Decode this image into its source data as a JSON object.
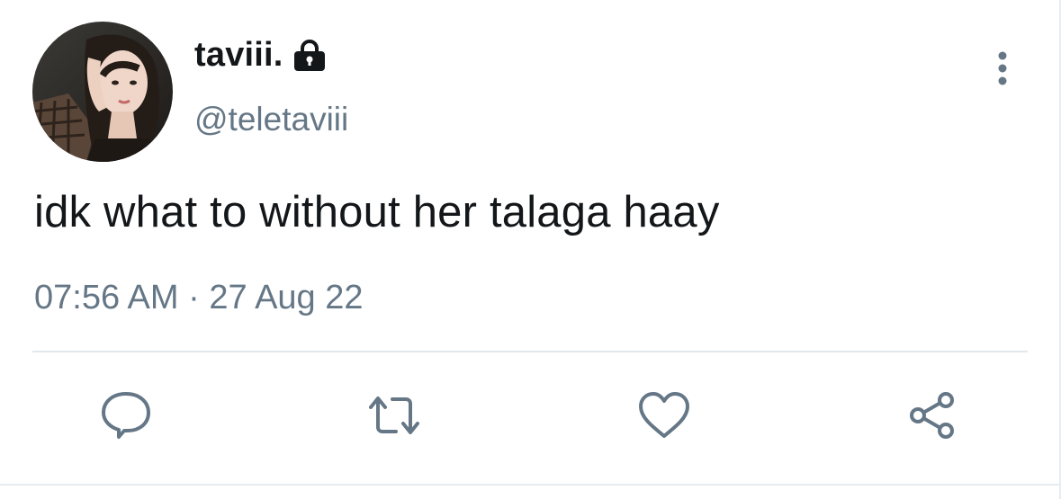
{
  "user": {
    "display_name": "taviii.",
    "handle": "@teletaviii",
    "protected_icon": "lock-icon",
    "avatar_icon": "profile-photo"
  },
  "tweet": {
    "text": "idk what to without her talaga haay",
    "time": "07:56 AM",
    "separator": "·",
    "date": "27 Aug 22"
  },
  "header": {
    "more_icon": "more-vertical-icon"
  },
  "actions": [
    {
      "icon": "reply-icon"
    },
    {
      "icon": "retweet-icon"
    },
    {
      "icon": "like-icon"
    },
    {
      "icon": "share-icon"
    }
  ],
  "colors": {
    "text_primary": "#14171a",
    "text_secondary": "#657786",
    "divider": "#e1e8ed",
    "icon": "#657786"
  }
}
